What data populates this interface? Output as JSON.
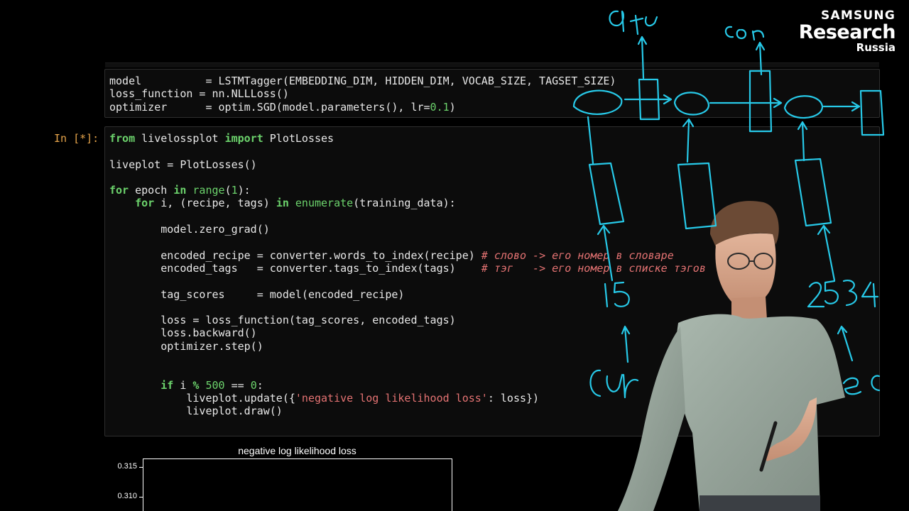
{
  "brand": {
    "line1": "SAMSUNG",
    "line2": "Research",
    "line3": "Russia"
  },
  "cell1": {
    "lines": [
      [
        {
          "t": "model          = LSTMTagger(EMBEDDING_DIM, HIDDEN_DIM, VOCAB_SIZE, TAGSET_SIZE)",
          "c": ""
        }
      ],
      [
        {
          "t": "loss_function = nn.NLLLoss()",
          "c": ""
        }
      ],
      [
        {
          "t": "optimizer      = optim.SGD(model.parameters(), lr=",
          "c": ""
        },
        {
          "t": "0.1",
          "c": "num"
        },
        {
          "t": ")",
          "c": ""
        }
      ]
    ]
  },
  "cell2": {
    "prompt": "In [*]:",
    "lines": [
      [
        {
          "t": "from",
          "c": "kw"
        },
        {
          "t": " livelossplot ",
          "c": ""
        },
        {
          "t": "import",
          "c": "kw"
        },
        {
          "t": " PlotLosses",
          "c": ""
        }
      ],
      [],
      [
        {
          "t": "liveplot = PlotLosses()",
          "c": ""
        }
      ],
      [],
      [
        {
          "t": "for",
          "c": "kw"
        },
        {
          "t": " epoch ",
          "c": ""
        },
        {
          "t": "in",
          "c": "kw"
        },
        {
          "t": " ",
          "c": ""
        },
        {
          "t": "range",
          "c": "num"
        },
        {
          "t": "(",
          "c": ""
        },
        {
          "t": "1",
          "c": "num"
        },
        {
          "t": "):",
          "c": ""
        }
      ],
      [
        {
          "t": "    ",
          "c": ""
        },
        {
          "t": "for",
          "c": "kw"
        },
        {
          "t": " i, (recipe, tags) ",
          "c": ""
        },
        {
          "t": "in",
          "c": "kw"
        },
        {
          "t": " ",
          "c": ""
        },
        {
          "t": "enumerate",
          "c": "num"
        },
        {
          "t": "(training_data):",
          "c": ""
        }
      ],
      [],
      [
        {
          "t": "        model.zero_grad()",
          "c": ""
        }
      ],
      [],
      [
        {
          "t": "        encoded_recipe = converter.words_to_index(recipe) ",
          "c": ""
        },
        {
          "t": "# слово -> его номер в словаре",
          "c": "cmt"
        }
      ],
      [
        {
          "t": "        encoded_tags   = converter.tags_to_index(tags)    ",
          "c": ""
        },
        {
          "t": "# тэг   -> его номер в списке тэгов",
          "c": "cmt"
        }
      ],
      [],
      [
        {
          "t": "        tag_scores     = model(encoded_recipe)",
          "c": ""
        }
      ],
      [],
      [
        {
          "t": "        loss = loss_function(tag_scores, encoded_tags)",
          "c": ""
        }
      ],
      [
        {
          "t": "        loss.backward()",
          "c": ""
        }
      ],
      [
        {
          "t": "        optimizer.step()",
          "c": ""
        }
      ],
      [],
      [],
      [
        {
          "t": "        ",
          "c": ""
        },
        {
          "t": "if",
          "c": "kw"
        },
        {
          "t": " i ",
          "c": ""
        },
        {
          "t": "%",
          "c": "kw"
        },
        {
          "t": " ",
          "c": ""
        },
        {
          "t": "500",
          "c": "num"
        },
        {
          "t": " == ",
          "c": ""
        },
        {
          "t": "0",
          "c": "num"
        },
        {
          "t": ":",
          "c": ""
        }
      ],
      [
        {
          "t": "            liveplot.update({",
          "c": ""
        },
        {
          "t": "'negative log likelihood loss'",
          "c": "str"
        },
        {
          "t": ": loss})",
          "c": ""
        }
      ],
      [
        {
          "t": "            liveplot.draw()",
          "c": ""
        }
      ]
    ]
  },
  "chart": {
    "title": "negative log likelihood loss",
    "yticks": [
      "0.315",
      "0.310"
    ]
  },
  "colors": {
    "background": "#000000",
    "keyword": "#6cd36c",
    "string": "#e57373",
    "prompt": "#e6a44a",
    "ink": "#27c9e8"
  },
  "whiteboard_ink": {
    "words": [
      "ЧТО",
      "СОЛ",
      "15",
      "2534",
      "СИР",
      "ЕЦ"
    ]
  }
}
